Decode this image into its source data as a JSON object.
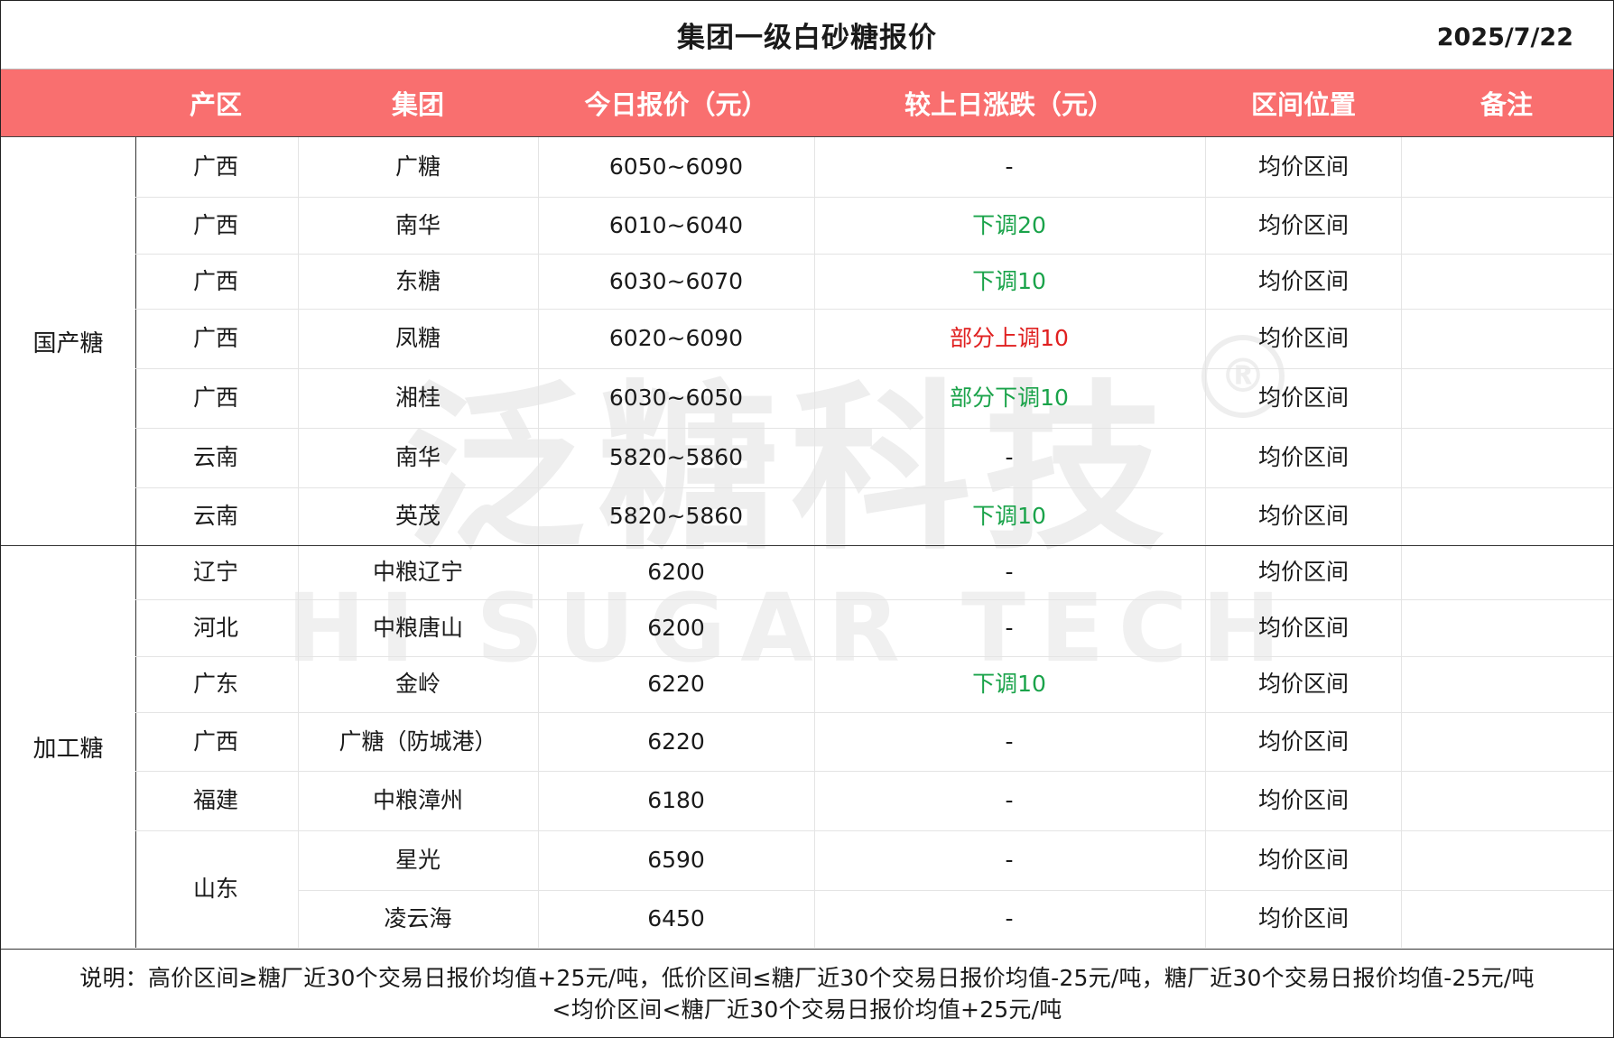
{
  "title": "集团一级白砂糖报价",
  "date": "2025/7/22",
  "headers": [
    "产区",
    "集团",
    "今日报价（元）",
    "较上日涨跌（元）",
    "区间位置",
    "备注"
  ],
  "watermark": {
    "cn": "泛糖科技",
    "en": "HI SUGAR TECH",
    "reg": "®"
  },
  "groups": [
    {
      "name": "国产糖",
      "rows": [
        {
          "region": "广西",
          "group": "广糖",
          "price": "6050~6090",
          "change": "-",
          "change_type": "none",
          "position": "均价区间",
          "remark": ""
        },
        {
          "region": "广西",
          "group": "南华",
          "price": "6010~6040",
          "change": "下调20",
          "change_type": "down",
          "position": "均价区间",
          "remark": ""
        },
        {
          "region": "广西",
          "group": "东糖",
          "price": "6030~6070",
          "change": "下调10",
          "change_type": "down",
          "position": "均价区间",
          "remark": ""
        },
        {
          "region": "广西",
          "group": "凤糖",
          "price": "6020~6090",
          "change": "部分上调10",
          "change_type": "up",
          "position": "均价区间",
          "remark": ""
        },
        {
          "region": "广西",
          "group": "湘桂",
          "price": "6030~6050",
          "change": "部分下调10",
          "change_type": "down",
          "position": "均价区间",
          "remark": ""
        },
        {
          "region": "云南",
          "group": "南华",
          "price": "5820~5860",
          "change": "-",
          "change_type": "none",
          "position": "均价区间",
          "remark": ""
        },
        {
          "region": "云南",
          "group": "英茂",
          "price": "5820~5860",
          "change": "下调10",
          "change_type": "down",
          "position": "均价区间",
          "remark": ""
        }
      ]
    },
    {
      "name": "加工糖",
      "rows": [
        {
          "region": "辽宁",
          "group": "中粮辽宁",
          "price": "6200",
          "change": "-",
          "change_type": "none",
          "position": "均价区间",
          "remark": ""
        },
        {
          "region": "河北",
          "group": "中粮唐山",
          "price": "6200",
          "change": "-",
          "change_type": "none",
          "position": "均价区间",
          "remark": ""
        },
        {
          "region": "广东",
          "group": "金岭",
          "price": "6220",
          "change": "下调10",
          "change_type": "down",
          "position": "均价区间",
          "remark": ""
        },
        {
          "region": "广西",
          "group": "广糖（防城港）",
          "price": "6220",
          "change": "-",
          "change_type": "none",
          "position": "均价区间",
          "remark": ""
        },
        {
          "region": "福建",
          "group": "中粮漳州",
          "price": "6180",
          "change": "-",
          "change_type": "none",
          "position": "均价区间",
          "remark": ""
        },
        {
          "region": "山东",
          "group": "星光",
          "price": "6590",
          "change": "-",
          "change_type": "none",
          "position": "均价区间",
          "remark": ""
        },
        {
          "region": "",
          "group": "凌云海",
          "price": "6450",
          "change": "-",
          "change_type": "none",
          "position": "均价区间",
          "remark": ""
        }
      ]
    }
  ],
  "footnote_line1": "说明：高价区间≥糖厂近30个交易日报价均值+25元/吨，低价区间≤糖厂近30个交易日报价均值-25元/吨，糖厂近30个交易日报价均值-25元/吨",
  "footnote_line2": "<均价区间<糖厂近30个交易日报价均值+25元/吨",
  "colors": {
    "header_bg": "#f96f6f",
    "down": "#1aa34a",
    "up": "#e02020",
    "neutral": "#1a1a1a"
  }
}
